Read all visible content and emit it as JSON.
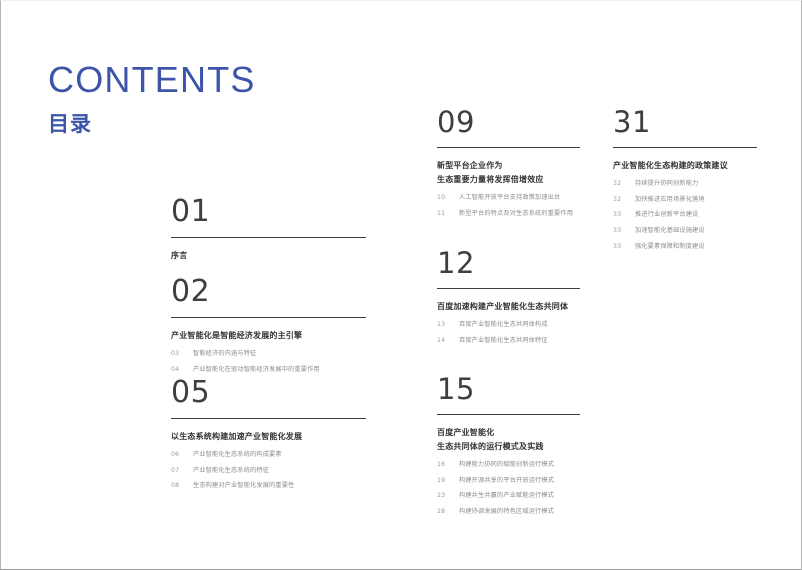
{
  "masthead": {
    "title": "CONTENTS",
    "subtitle": "目录",
    "accent_color": "#3c55a8"
  },
  "columns": [
    {
      "name": "column-1",
      "entries": [
        {
          "number": "01",
          "title_lines": [
            "序言"
          ],
          "sub_items": []
        },
        {
          "number": "02",
          "title_lines": [
            "产业智能化是智能经济发展的主引擎"
          ],
          "sub_items": [
            {
              "page": "03",
              "text": "智能经济的内涵与特征"
            },
            {
              "page": "04",
              "text": "产业智能化在驱动智能经济发展中的重要作用"
            }
          ]
        },
        {
          "number": "05",
          "title_lines": [
            "以生态系统构建加速产业智能化发展"
          ],
          "sub_items": [
            {
              "page": "06",
              "text": "产业智能化生态系统的构成要素"
            },
            {
              "page": "07",
              "text": "产业智能化生态系统的特征"
            },
            {
              "page": "08",
              "text": "生态构建对产业智能化发展的重要性"
            }
          ]
        }
      ]
    },
    {
      "name": "column-2",
      "entries": [
        {
          "number": "09",
          "title_lines": [
            "新型平台企业作为",
            "生态重要力量将发挥倍增效应"
          ],
          "sub_items": [
            {
              "page": "10",
              "text": "人工智能开放平台支持政策加速出台"
            },
            {
              "page": "11",
              "text": "新型平台的特点及对生态系统的重要作用"
            }
          ]
        },
        {
          "number": "12",
          "title_lines": [
            "百度加速构建产业智能化生态共同体"
          ],
          "sub_items": [
            {
              "page": "13",
              "text": "百度产业智能化生态共同体构成"
            },
            {
              "page": "14",
              "text": "百度产业智能化生态共同体特征"
            }
          ]
        },
        {
          "number": "15",
          "title_lines": [
            "百度产业智能化",
            "生态共同体的运行模式及实践"
          ],
          "sub_items": [
            {
              "page": "16",
              "text": "构建能力协同的赋能创新运行模式"
            },
            {
              "page": "19",
              "text": "构建开源共享的平台开放运行模式"
            },
            {
              "page": "23",
              "text": "构建共生共赢的产业赋能运行模式"
            },
            {
              "page": "28",
              "text": "构建协调发展的特色区域运行模式"
            }
          ]
        }
      ]
    },
    {
      "name": "column-3",
      "entries": [
        {
          "number": "31",
          "title_lines": [
            "产业智能化生态构建的政策建议"
          ],
          "sub_items": [
            {
              "page": "32",
              "text": "持续提升协同创新能力"
            },
            {
              "page": "32",
              "text": "加快推进应用场景化落地"
            },
            {
              "page": "33",
              "text": "推进行业创新平台建设"
            },
            {
              "page": "33",
              "text": "加速智能化基础设施建设"
            },
            {
              "page": "33",
              "text": "强化要素保障和制度建设"
            }
          ]
        }
      ]
    }
  ]
}
